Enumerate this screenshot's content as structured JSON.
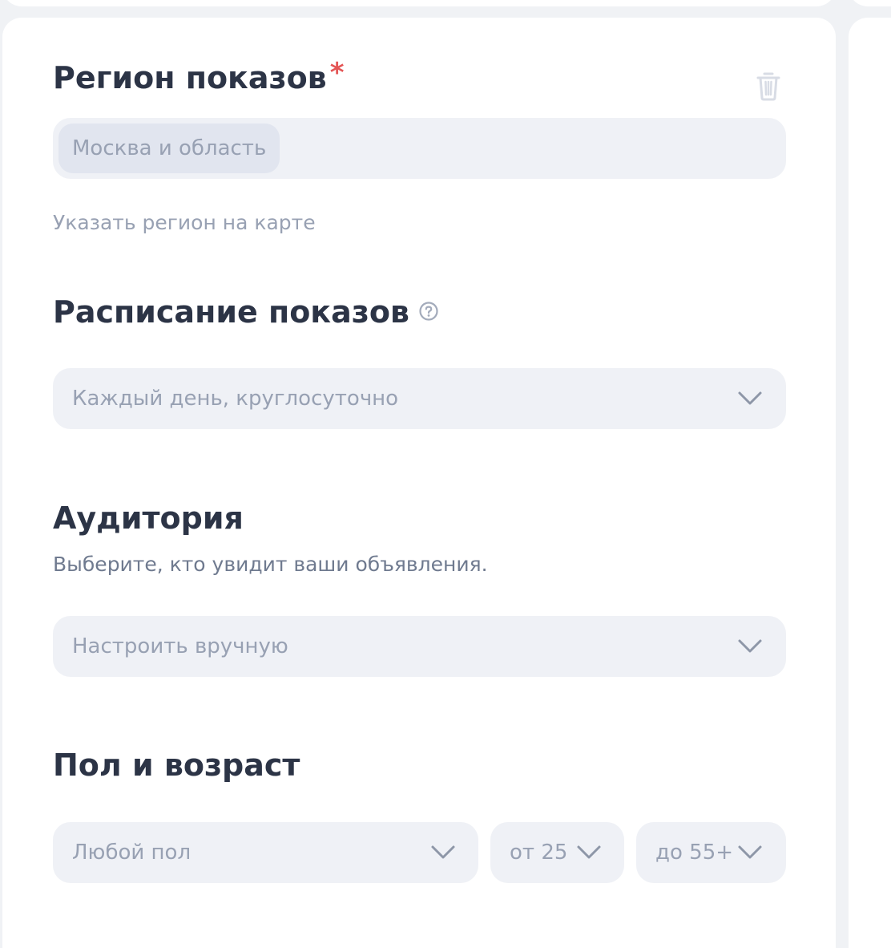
{
  "region": {
    "title": "Регион показов",
    "required_mark": "*",
    "chip": "Москва и область",
    "map_link": "Указать регион на карте"
  },
  "schedule": {
    "title": "Расписание показов",
    "value": "Каждый день, круглосуточно"
  },
  "audience": {
    "title": "Аудитория",
    "description": "Выберите, кто увидит ваши объявления.",
    "value": "Настроить вручную"
  },
  "gender_age": {
    "title": "Пол и возраст",
    "gender": "Любой пол",
    "age_from": "от 25",
    "age_to": "до 55+"
  },
  "colors": {
    "heading": "#2c3446",
    "required": "#e45656",
    "field_bg": "#eff1f6",
    "placeholder": "#98a1b3",
    "page_bg": "#f0f2f5"
  },
  "icons": {
    "delete": "trash-icon",
    "help": "help-icon",
    "dropdown": "chevron-down-icon"
  }
}
